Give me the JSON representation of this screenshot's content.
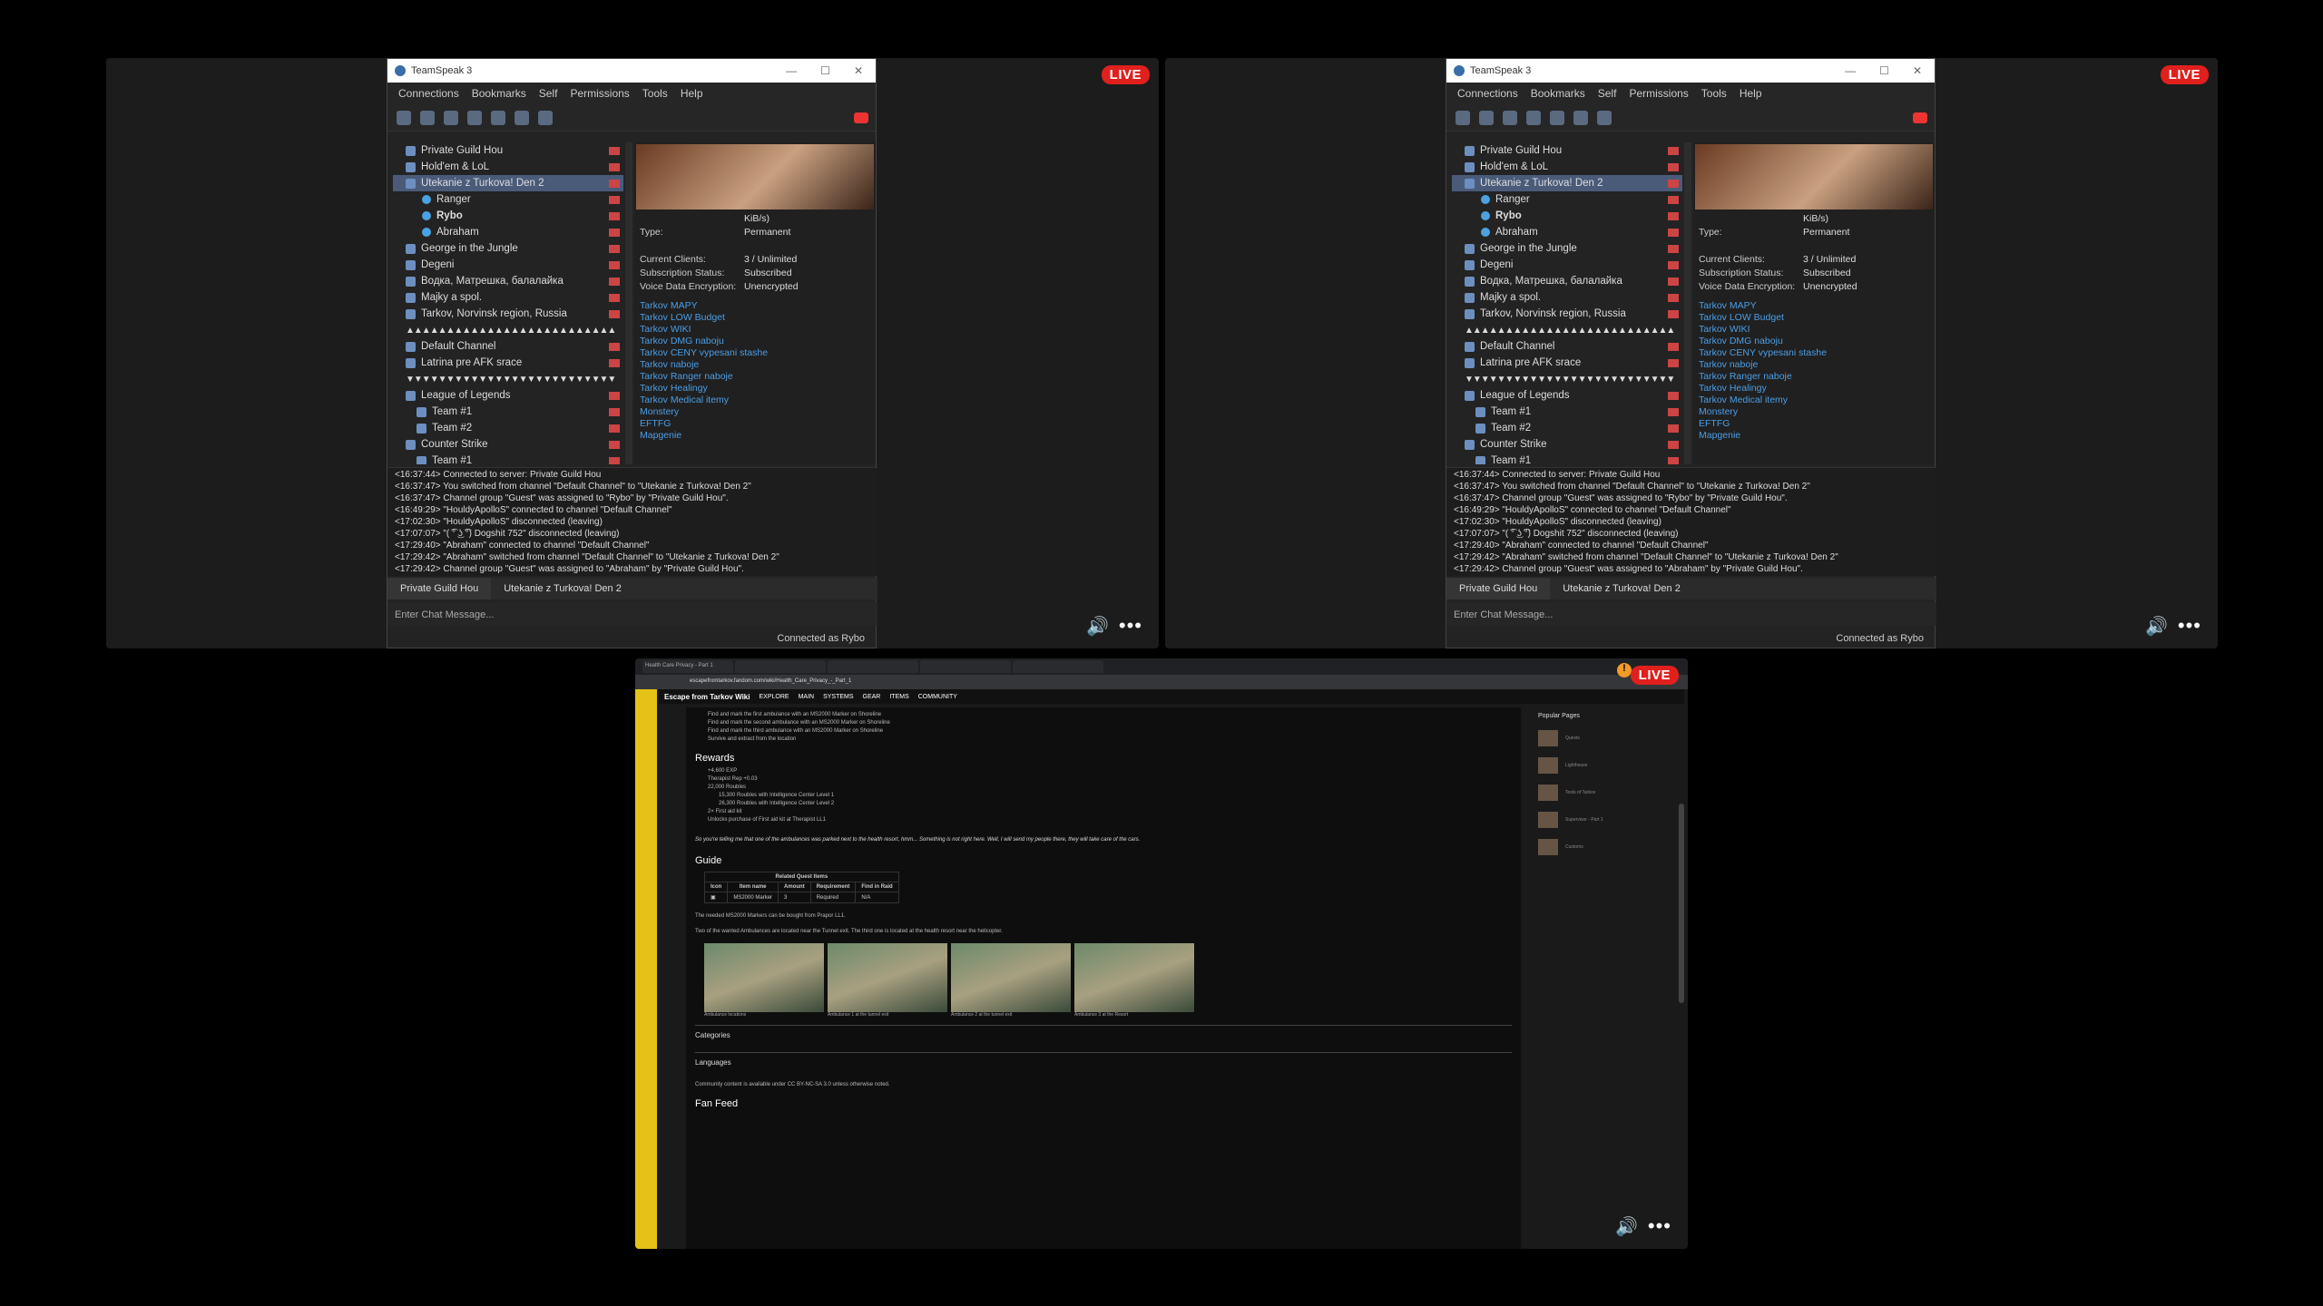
{
  "ts": {
    "title": "TeamSpeak 3",
    "menu": [
      "Connections",
      "Bookmarks",
      "Self",
      "Permissions",
      "Tools",
      "Help"
    ],
    "tree": [
      {
        "t": "ch",
        "label": "Private Guild Hou"
      },
      {
        "t": "ch",
        "label": "Hold'em & LoL"
      },
      {
        "t": "ch",
        "label": "Utekanie z Turkova! Den 2",
        "sel": true
      },
      {
        "t": "cl",
        "label": "Ranger"
      },
      {
        "t": "cl",
        "label": "Rybo",
        "bold": true
      },
      {
        "t": "cl",
        "label": "Abraham"
      },
      {
        "t": "ch",
        "label": "George in the Jungle"
      },
      {
        "t": "ch",
        "label": "Degeni"
      },
      {
        "t": "ch",
        "label": "Водка, Матрешка, балалайка"
      },
      {
        "t": "ch",
        "label": "Majky a spol."
      },
      {
        "t": "ch",
        "label": "Tarkov, Norvinsk region, Russia"
      },
      {
        "t": "sep",
        "label": "▲▲▲▲▲▲▲▲▲▲▲▲▲▲▲▲▲▲▲▲▲▲▲▲▲▲"
      },
      {
        "t": "ch",
        "label": "Default Channel"
      },
      {
        "t": "ch",
        "label": "Latrina pre AFK srace"
      },
      {
        "t": "sep",
        "label": "▼▼▼▼▼▼▼▼▼▼▼▼▼▼▼▼▼▼▼▼▼▼▼▼▼▼"
      },
      {
        "t": "ch",
        "label": "League of Legends"
      },
      {
        "t": "ch",
        "label": "Team #1"
      },
      {
        "t": "ch",
        "label": "Team #2"
      },
      {
        "t": "ch",
        "label": "Counter Strike"
      },
      {
        "t": "ch",
        "label": "Team #1"
      }
    ],
    "info": [
      [
        "",
        "KiB/s)"
      ],
      [
        "Type:",
        "Permanent"
      ],
      [
        "",
        ""
      ],
      [
        "Current Clients:",
        "3 / Unlimited"
      ],
      [
        "Subscription Status:",
        "Subscribed"
      ],
      [
        "Voice Data Encryption:",
        "Unencrypted"
      ]
    ],
    "links": [
      "Tarkov MAPY",
      "Tarkov LOW Budget",
      "Tarkov WIKI",
      "Tarkov DMG naboju",
      "Tarkov CENY vypesani stashe",
      "Tarkov naboje",
      "Tarkov Ranger naboje",
      "Tarkov Healingy",
      "Tarkov Medical itemy",
      "Monstery",
      "EFTFG",
      "Mapgenie"
    ],
    "chat": [
      "<16:37:44> Connected to server: Private Guild Hou",
      "<16:37:47> You switched from channel \"Default Channel\" to \"Utekanie z Turkova! Den 2\"",
      "<16:37:47> Channel group \"Guest\" was assigned to \"Rybo\" by \"Private Guild Hou\".",
      "<16:49:29> \"HouldyApolloS\" connected to channel \"Default Channel\"",
      "<17:02:30> \"HouldyApolloS\" disconnected (leaving)",
      "<17:07:07> \"( ͡° ͜ʖ ͡°) Dogshit 752\" disconnected (leaving)",
      "<17:29:40> \"Abraham\" connected to channel \"Default Channel\"",
      "<17:29:42> \"Abraham\" switched from channel \"Default Channel\" to \"Utekanie z Turkova! Den 2\"",
      "<17:29:42> Channel group \"Guest\" was assigned to \"Abraham\" by \"Private Guild Hou\"."
    ],
    "tab1": "Private Guild Hou",
    "tab2": "Utekanie z Turkova! Den 2",
    "input_placeholder": "Enter Chat Message...",
    "status": "Connected as Rybo"
  },
  "live": "LIVE",
  "wiki": {
    "site": "Escape from Tarkov Wiki",
    "url": "escapefromtarkov.fandom.com/wiki/Health_Care_Privacy_-_Part_1",
    "nav": [
      "EXPLORE",
      "MAIN",
      "SYSTEMS",
      "GEAR",
      "ITEMS",
      "COMMUNITY"
    ],
    "tasks": [
      "Find and mark the first ambulance with an MS2000 Marker on Shoreline",
      "Find and mark the second ambulance with an MS2000 Marker on Shoreline",
      "Find and mark the third ambulance with an MS2000 Marker on Shoreline",
      "Survive and extract from the location"
    ],
    "rewards_h": "Rewards",
    "rewards": [
      "+4,600 EXP",
      "Therapist Rep +0.03",
      "22,000 Roubles",
      "15,300 Roubles with Intelligence Center Level 1",
      "26,300 Roubles with Intelligence Center Level 2",
      "2× First aid kit",
      "Unlocks purchase of First aid kit at Therapist LL1"
    ],
    "quote": "So you're telling me that one of the ambulances was parked next to the health resort, hmm... Something is not right here. Well, I will send my people there, they will take care of the cars.",
    "guide_h": "Guide",
    "table_title": "Related Quest Items",
    "table_head": [
      "Icon",
      "Item name",
      "Amount",
      "Requirement",
      "Find in Raid"
    ],
    "table_row": [
      "",
      "MS2000 Marker",
      "3",
      "Required",
      "N/A"
    ],
    "text1": "The needed MS2000 Markers can be bought from Prapor LL1.",
    "text2": "Two of the wanted Ambulances are located near the Tunnel exit. The third one is located at the health resort near the helicopter.",
    "captions": [
      "Ambulance locations",
      "Ambulance 1 at the tunnel exit",
      "Ambulance 2 at the tunnel exit",
      "Ambulance 3 at the Resort"
    ],
    "categories": "Categories",
    "languages": "Languages",
    "license": "Community content is available under CC BY-NC-SA 3.0 unless otherwise noted.",
    "fanfeed": "Fan Feed",
    "popular_h": "Popular Pages",
    "popular": [
      "Quests",
      "Lighthouse",
      "Tools of Tarkov",
      "Supervisor - Part 1",
      "Customs"
    ]
  }
}
